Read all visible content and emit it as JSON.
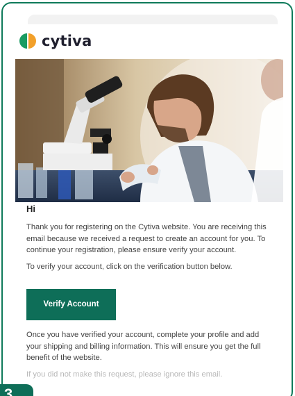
{
  "brand": {
    "name": "cytiva",
    "colors": {
      "accent": "#0e6e58",
      "frame": "#0e7a5a",
      "logo_green": "#1a9b62",
      "logo_orange": "#f2a02a"
    }
  },
  "hero": {
    "icon": "scientist-microscope-photo"
  },
  "email": {
    "greeting": "Hi",
    "para1": "Thank you for registering on the Cytiva website. You are receiving this email because we received a request to create an account for you. To continue your registration, please ensure verify your account.",
    "para2": "To verify your account, click on the verification button below.",
    "verify_label": "Verify Account",
    "para3": "Once you have verified your account, complete your profile and add your shipping and billing information. This will ensure you get the full benefit of the website.",
    "para4": "If you did not make this request, please ignore this email."
  },
  "badge": {
    "number": "3"
  }
}
